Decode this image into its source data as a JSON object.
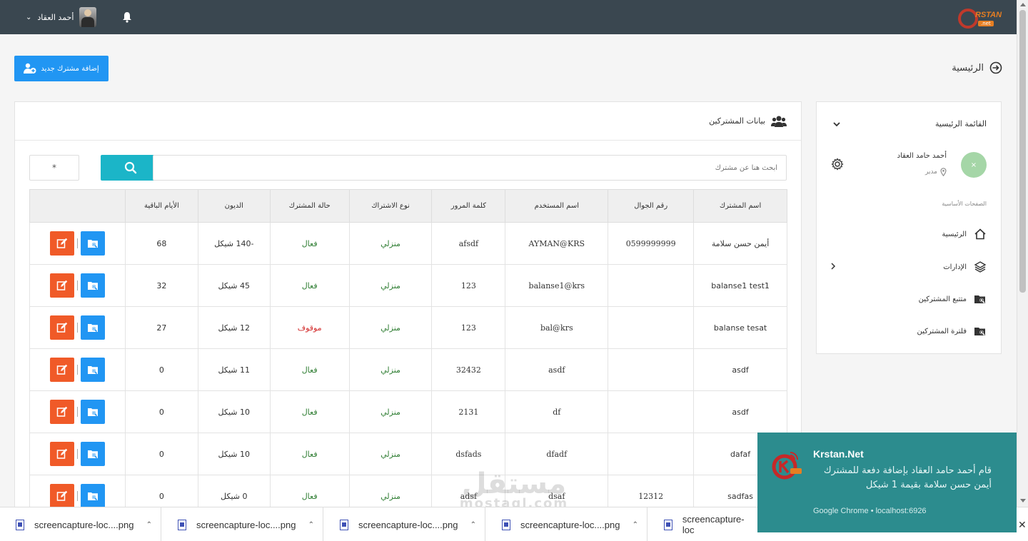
{
  "topbar": {
    "user_name": "أحمد العقاد",
    "caret": "⌄",
    "logo_text": "RSTAN",
    "logo_sub": ".net"
  },
  "add_button": {
    "label": "إضافة مشترك جديد"
  },
  "breadcrumb": {
    "label": "الرئيسية"
  },
  "panel": {
    "title": "بيانات المشتركين"
  },
  "search": {
    "placeholder": "ابحث هنا عن مشترك",
    "filter_value": "*"
  },
  "table": {
    "headers": [
      "اسم المشترك",
      "رقم الجوال",
      "اسم المستخدم",
      "كلمة المرور",
      "نوع الاشتراك",
      "حالة المشترك",
      "الديون",
      "الأيام الباقية",
      ""
    ],
    "rows": [
      {
        "name": "أيمن حسن سلامة",
        "phone": "0599999999",
        "username": "AYMAN@KRS",
        "password": "afsdf",
        "type": "منزلي",
        "status": "فعال",
        "status_on": true,
        "debt": "-140 شيكل",
        "days": "68"
      },
      {
        "name": "balanse1 test1",
        "phone": "",
        "username": "balanse1@krs",
        "password": "123",
        "type": "منزلي",
        "status": "فعال",
        "status_on": true,
        "debt": "45 شيكل",
        "days": "32"
      },
      {
        "name": "balanse tesat",
        "phone": "",
        "username": "bal@krs",
        "password": "123",
        "type": "منزلي",
        "status": "موقوف",
        "status_on": false,
        "debt": "12 شيكل",
        "days": "27"
      },
      {
        "name": "asdf",
        "phone": "",
        "username": "asdf",
        "password": "32432",
        "type": "منزلي",
        "status": "فعال",
        "status_on": true,
        "debt": "11 شيكل",
        "days": "0"
      },
      {
        "name": "asdf",
        "phone": "",
        "username": "df",
        "password": "2131",
        "type": "منزلي",
        "status": "فعال",
        "status_on": true,
        "debt": "10 شيكل",
        "days": "0"
      },
      {
        "name": "dafaf",
        "phone": "",
        "username": "dfadf",
        "password": "dsfads",
        "type": "منزلي",
        "status": "فعال",
        "status_on": true,
        "debt": "10 شيكل",
        "days": "0"
      },
      {
        "name": "sadfas",
        "phone": "12312",
        "username": "dsaf",
        "password": "adsf",
        "type": "منزلي",
        "status": "فعال",
        "status_on": true,
        "debt": "0 شيكل",
        "days": "0"
      }
    ]
  },
  "sidebar": {
    "title": "القائمة الرئيسية",
    "user_name": "أحمد حامد العقاد",
    "user_role": "مدير",
    "avatar_glyph": "×",
    "section_label": "الصفحات الأساسية",
    "items": [
      {
        "label": "الرئيسية",
        "icon": "home-icon"
      },
      {
        "label": "الإدارات",
        "icon": "layers-icon"
      },
      {
        "label": "متتبع المشتركين",
        "icon": "folder-search-icon"
      },
      {
        "label": "فلترة المشتركين",
        "icon": "folder-search-icon"
      }
    ]
  },
  "downloads": {
    "items": [
      "screencapture-loc....png",
      "screencapture-loc....png",
      "screencapture-loc....png",
      "screencapture-loc....png",
      "screencapture-loc"
    ]
  },
  "watermark": {
    "main": "مستقل",
    "sub": "mostaql.com"
  },
  "notification": {
    "title": "Krstan.Net",
    "body": "قام أحمد حامد العقاد بإضافة دفعة للمشترك أيمن حسن سلامة بقيمة 1 شيكل",
    "source": "Google Chrome • localhost:6926"
  },
  "colors": {
    "topbar": "#3a4750",
    "primary": "#2196f3",
    "search": "#1bb5c8",
    "edit": "#f05a28",
    "notification": "#2c8c8e"
  }
}
